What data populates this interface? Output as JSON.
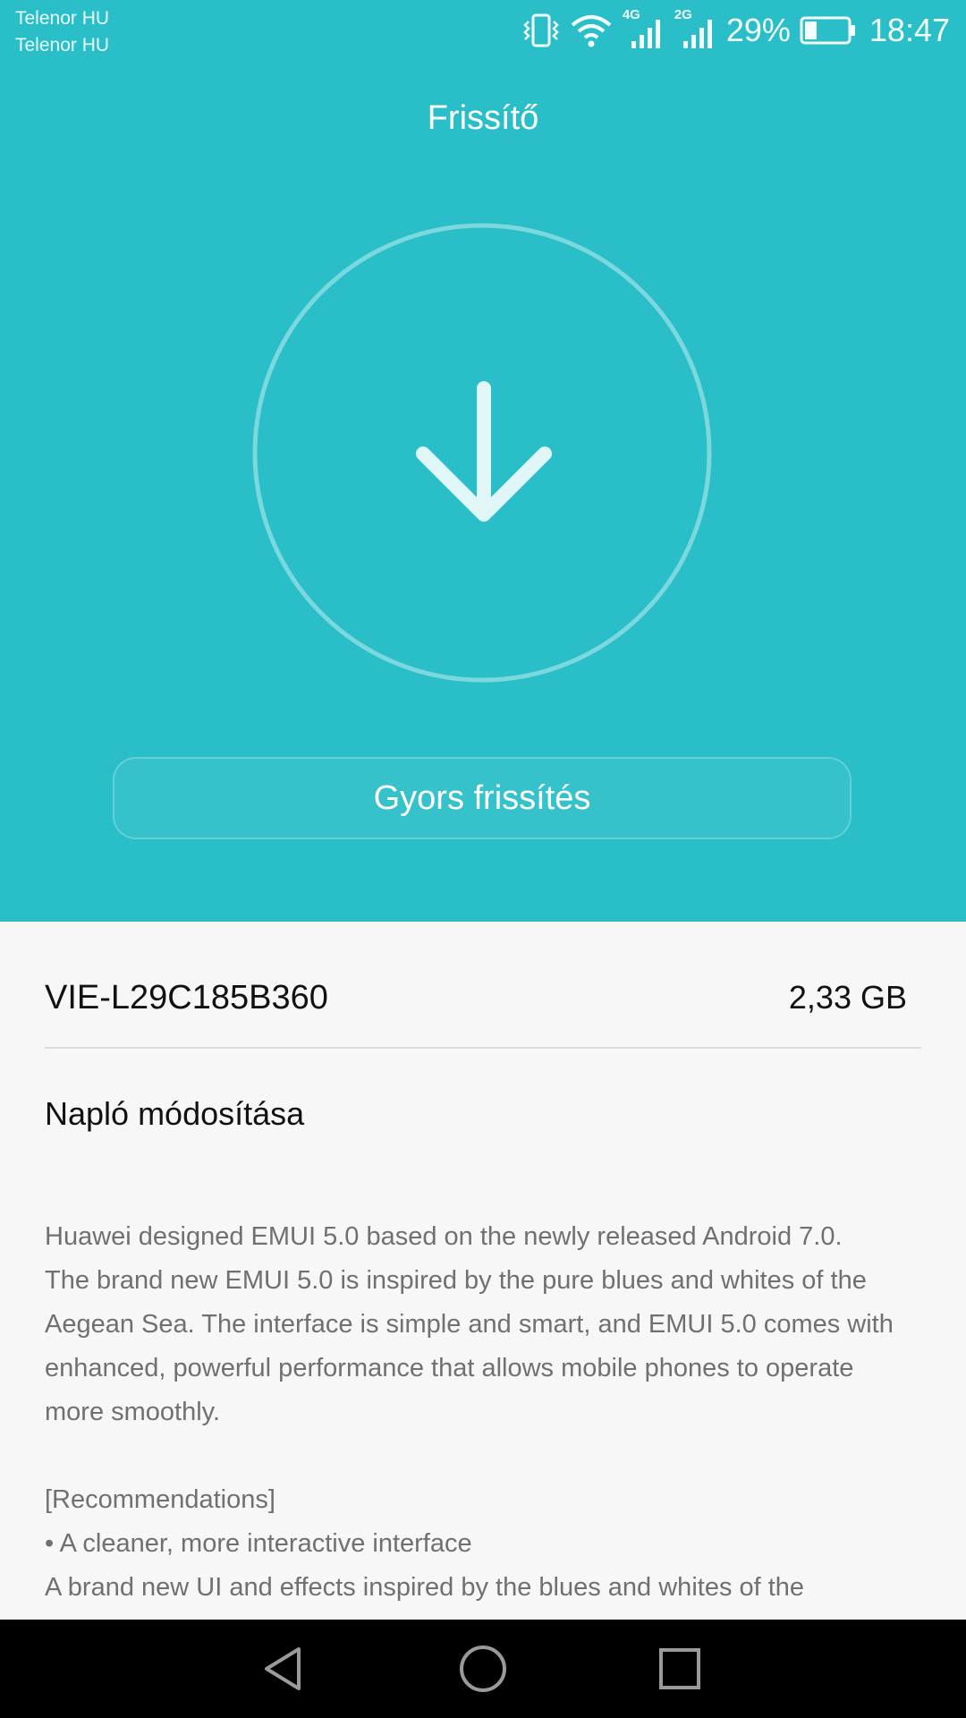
{
  "status_bar": {
    "carrier_1": "Telenor HU",
    "carrier_2": "Telenor HU",
    "network_1": "4G",
    "network_2": "2G",
    "battery_percent": "29%",
    "battery_level": 0.29,
    "time": "18:47",
    "icons": [
      "vibrate-icon",
      "wifi-icon",
      "signal-4g-icon",
      "signal-2g-icon",
      "battery-icon"
    ]
  },
  "header": {
    "title": "Frissítő"
  },
  "hero": {
    "icon": "download-arrow-icon",
    "quick_update_label": "Gyors frissítés"
  },
  "package": {
    "version": "VIE-L29C185B360",
    "size": "2,33 GB"
  },
  "changelog": {
    "title": "Napló módosítása",
    "paragraph_1": [
      "Huawei designed EMUI 5.0 based on the newly released Android 7.0.",
      "The brand new EMUI 5.0 is inspired by the pure blues and whites of the",
      "Aegean Sea. The interface is simple and smart, and EMUI 5.0 comes with",
      "enhanced, powerful performance that allows mobile phones to operate",
      "more smoothly."
    ],
    "recommendations_header": "[Recommendations]",
    "bullet_1": "• A cleaner, more interactive interface",
    "bullet_1_text": "A brand new UI and effects inspired by the blues and whites of the"
  },
  "nav_bar": {
    "buttons": [
      "back-icon",
      "home-icon",
      "recent-apps-icon"
    ]
  },
  "colors": {
    "accent": "#2abfc8",
    "background": "#f7f7f7",
    "body_text": "#707070",
    "title_text": "#111111",
    "nav_bar": "#000000"
  }
}
